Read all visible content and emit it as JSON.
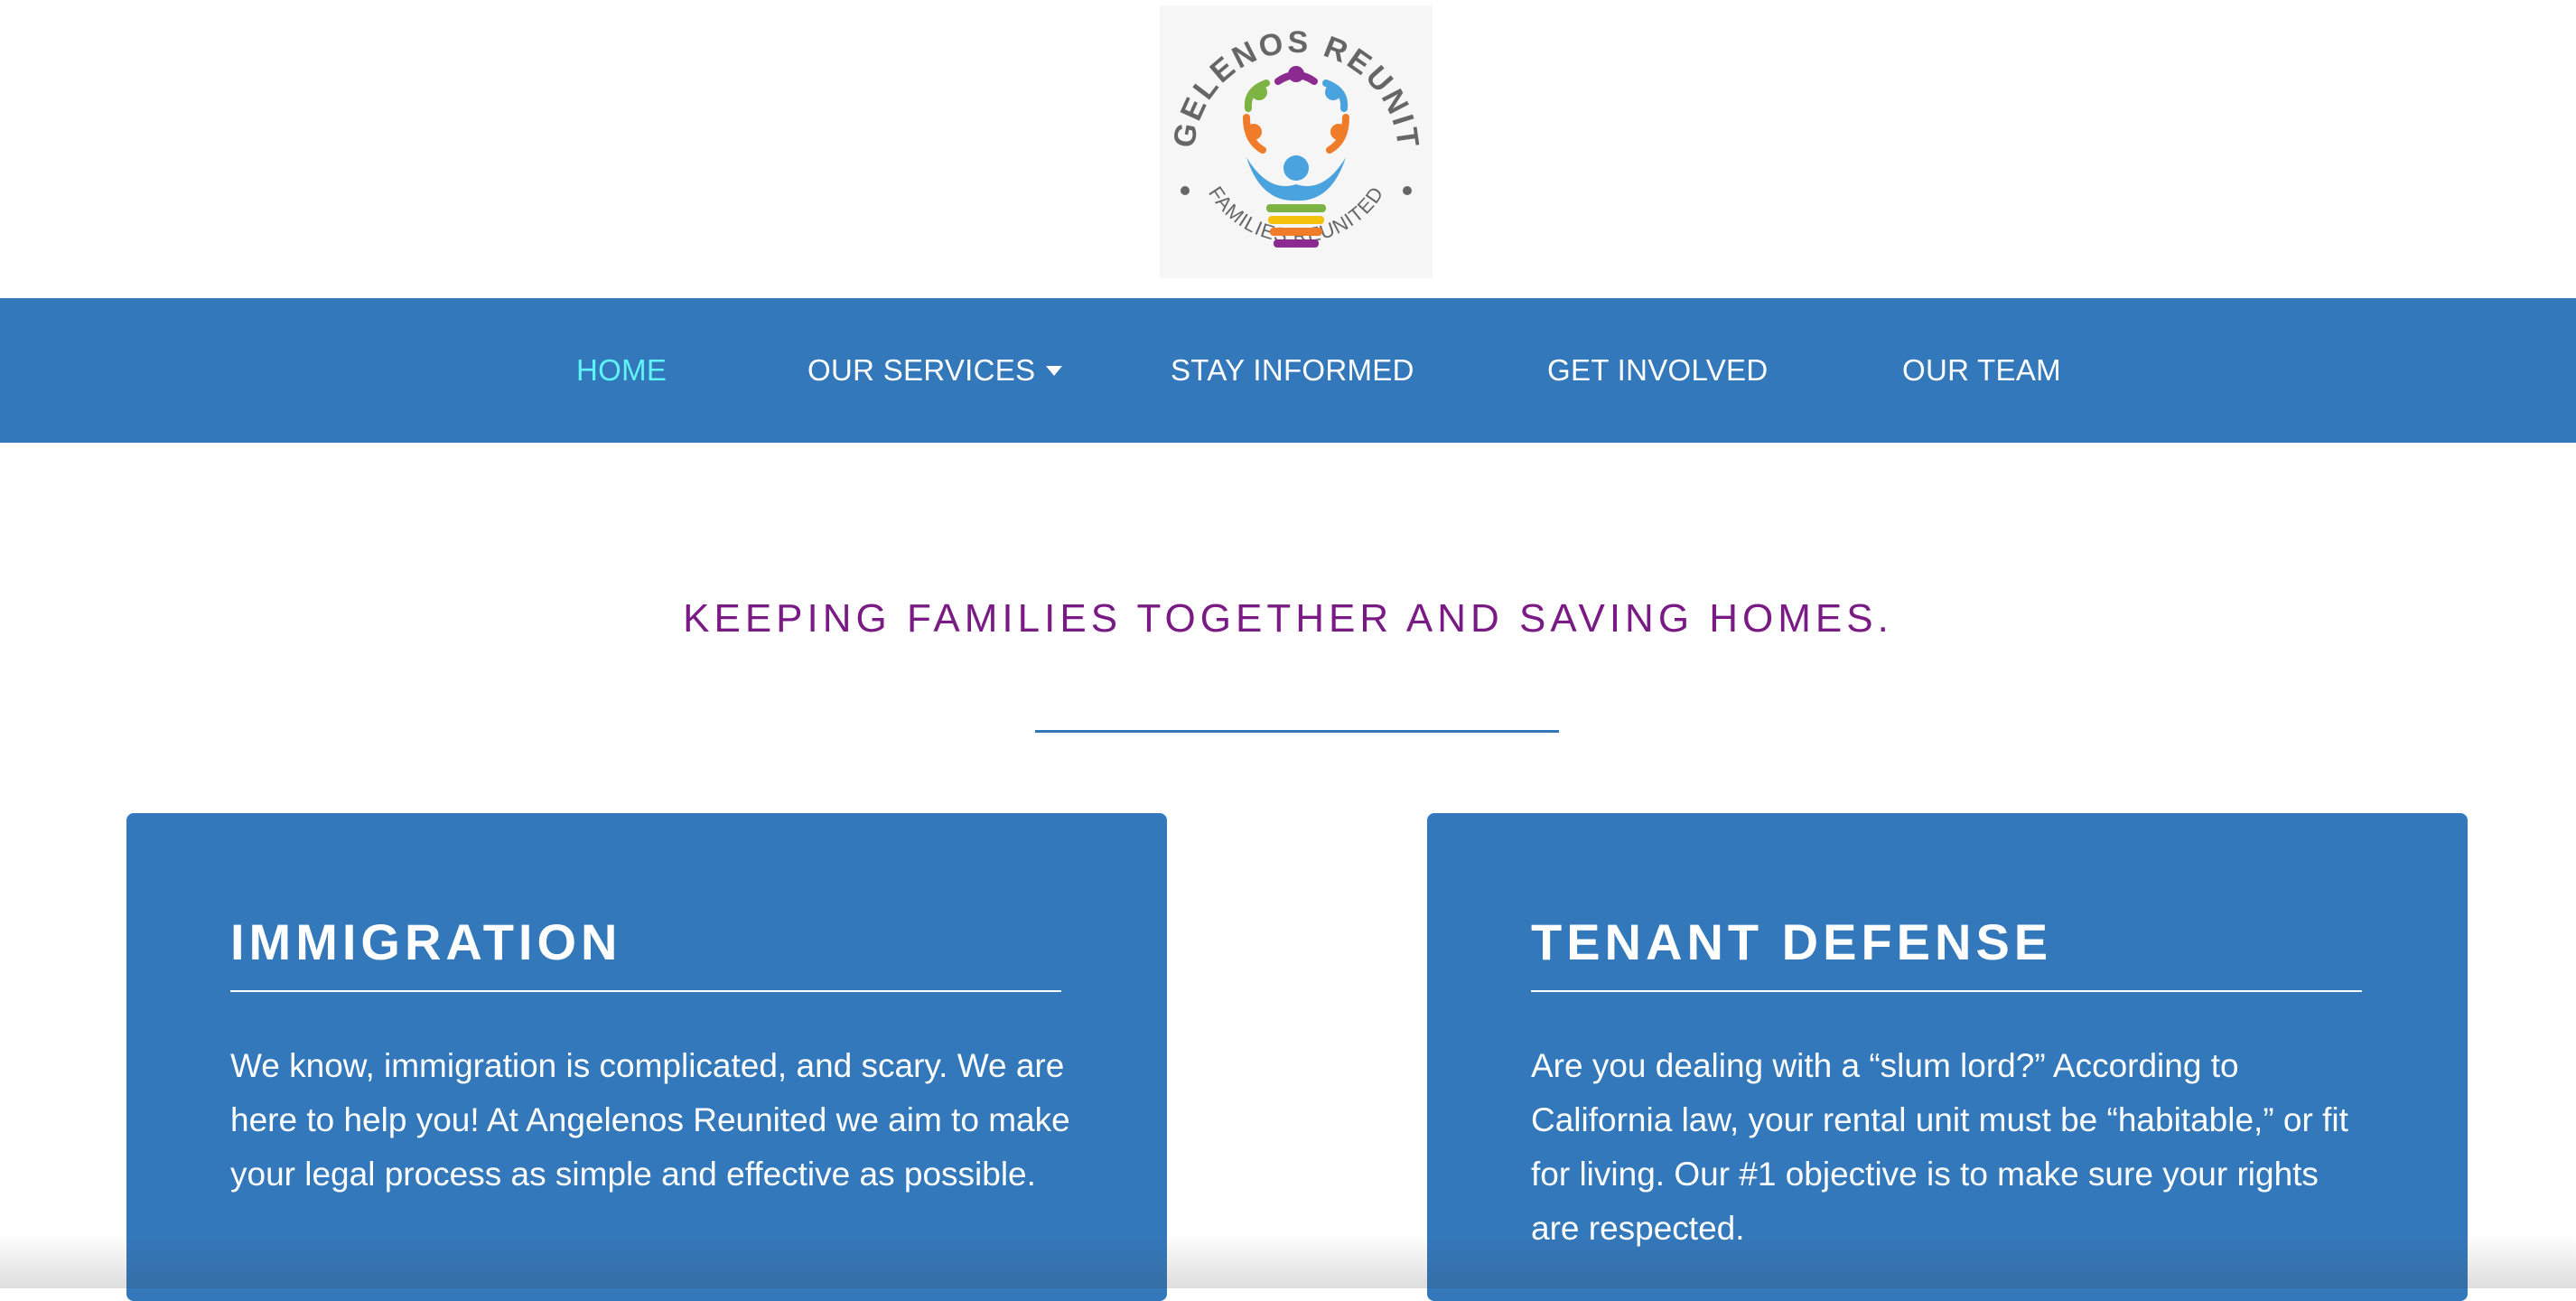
{
  "logo": {
    "top_text": "ANGELENOS REUNITED",
    "bottom_text": "FAMILIES REUNITED"
  },
  "nav": {
    "items": [
      {
        "label": "HOME",
        "active": true
      },
      {
        "label": "OUR SERVICES",
        "has_dropdown": true
      },
      {
        "label": "STAY INFORMED"
      },
      {
        "label": "GET INVOLVED"
      },
      {
        "label": "OUR TEAM"
      }
    ]
  },
  "hero": {
    "tagline": "KEEPING FAMILIES TOGETHER AND SAVING HOMES."
  },
  "cards": [
    {
      "title": "IMMIGRATION",
      "body": "We know, immigration is complicated, and scary. We are here to help you! At Angelenos Reunited we aim to make your legal process as simple and effective as possible."
    },
    {
      "title": "TENANT DEFENSE",
      "body": "Are you dealing with a “slum lord?” According to California law, your rental unit must be “habitable,” or fit for living. Our #1 objective is to make sure your rights are respected."
    }
  ],
  "colors": {
    "brand_blue": "#3378bb",
    "active_nav": "#5ff4f7",
    "tagline_purple": "#7a1a84"
  }
}
